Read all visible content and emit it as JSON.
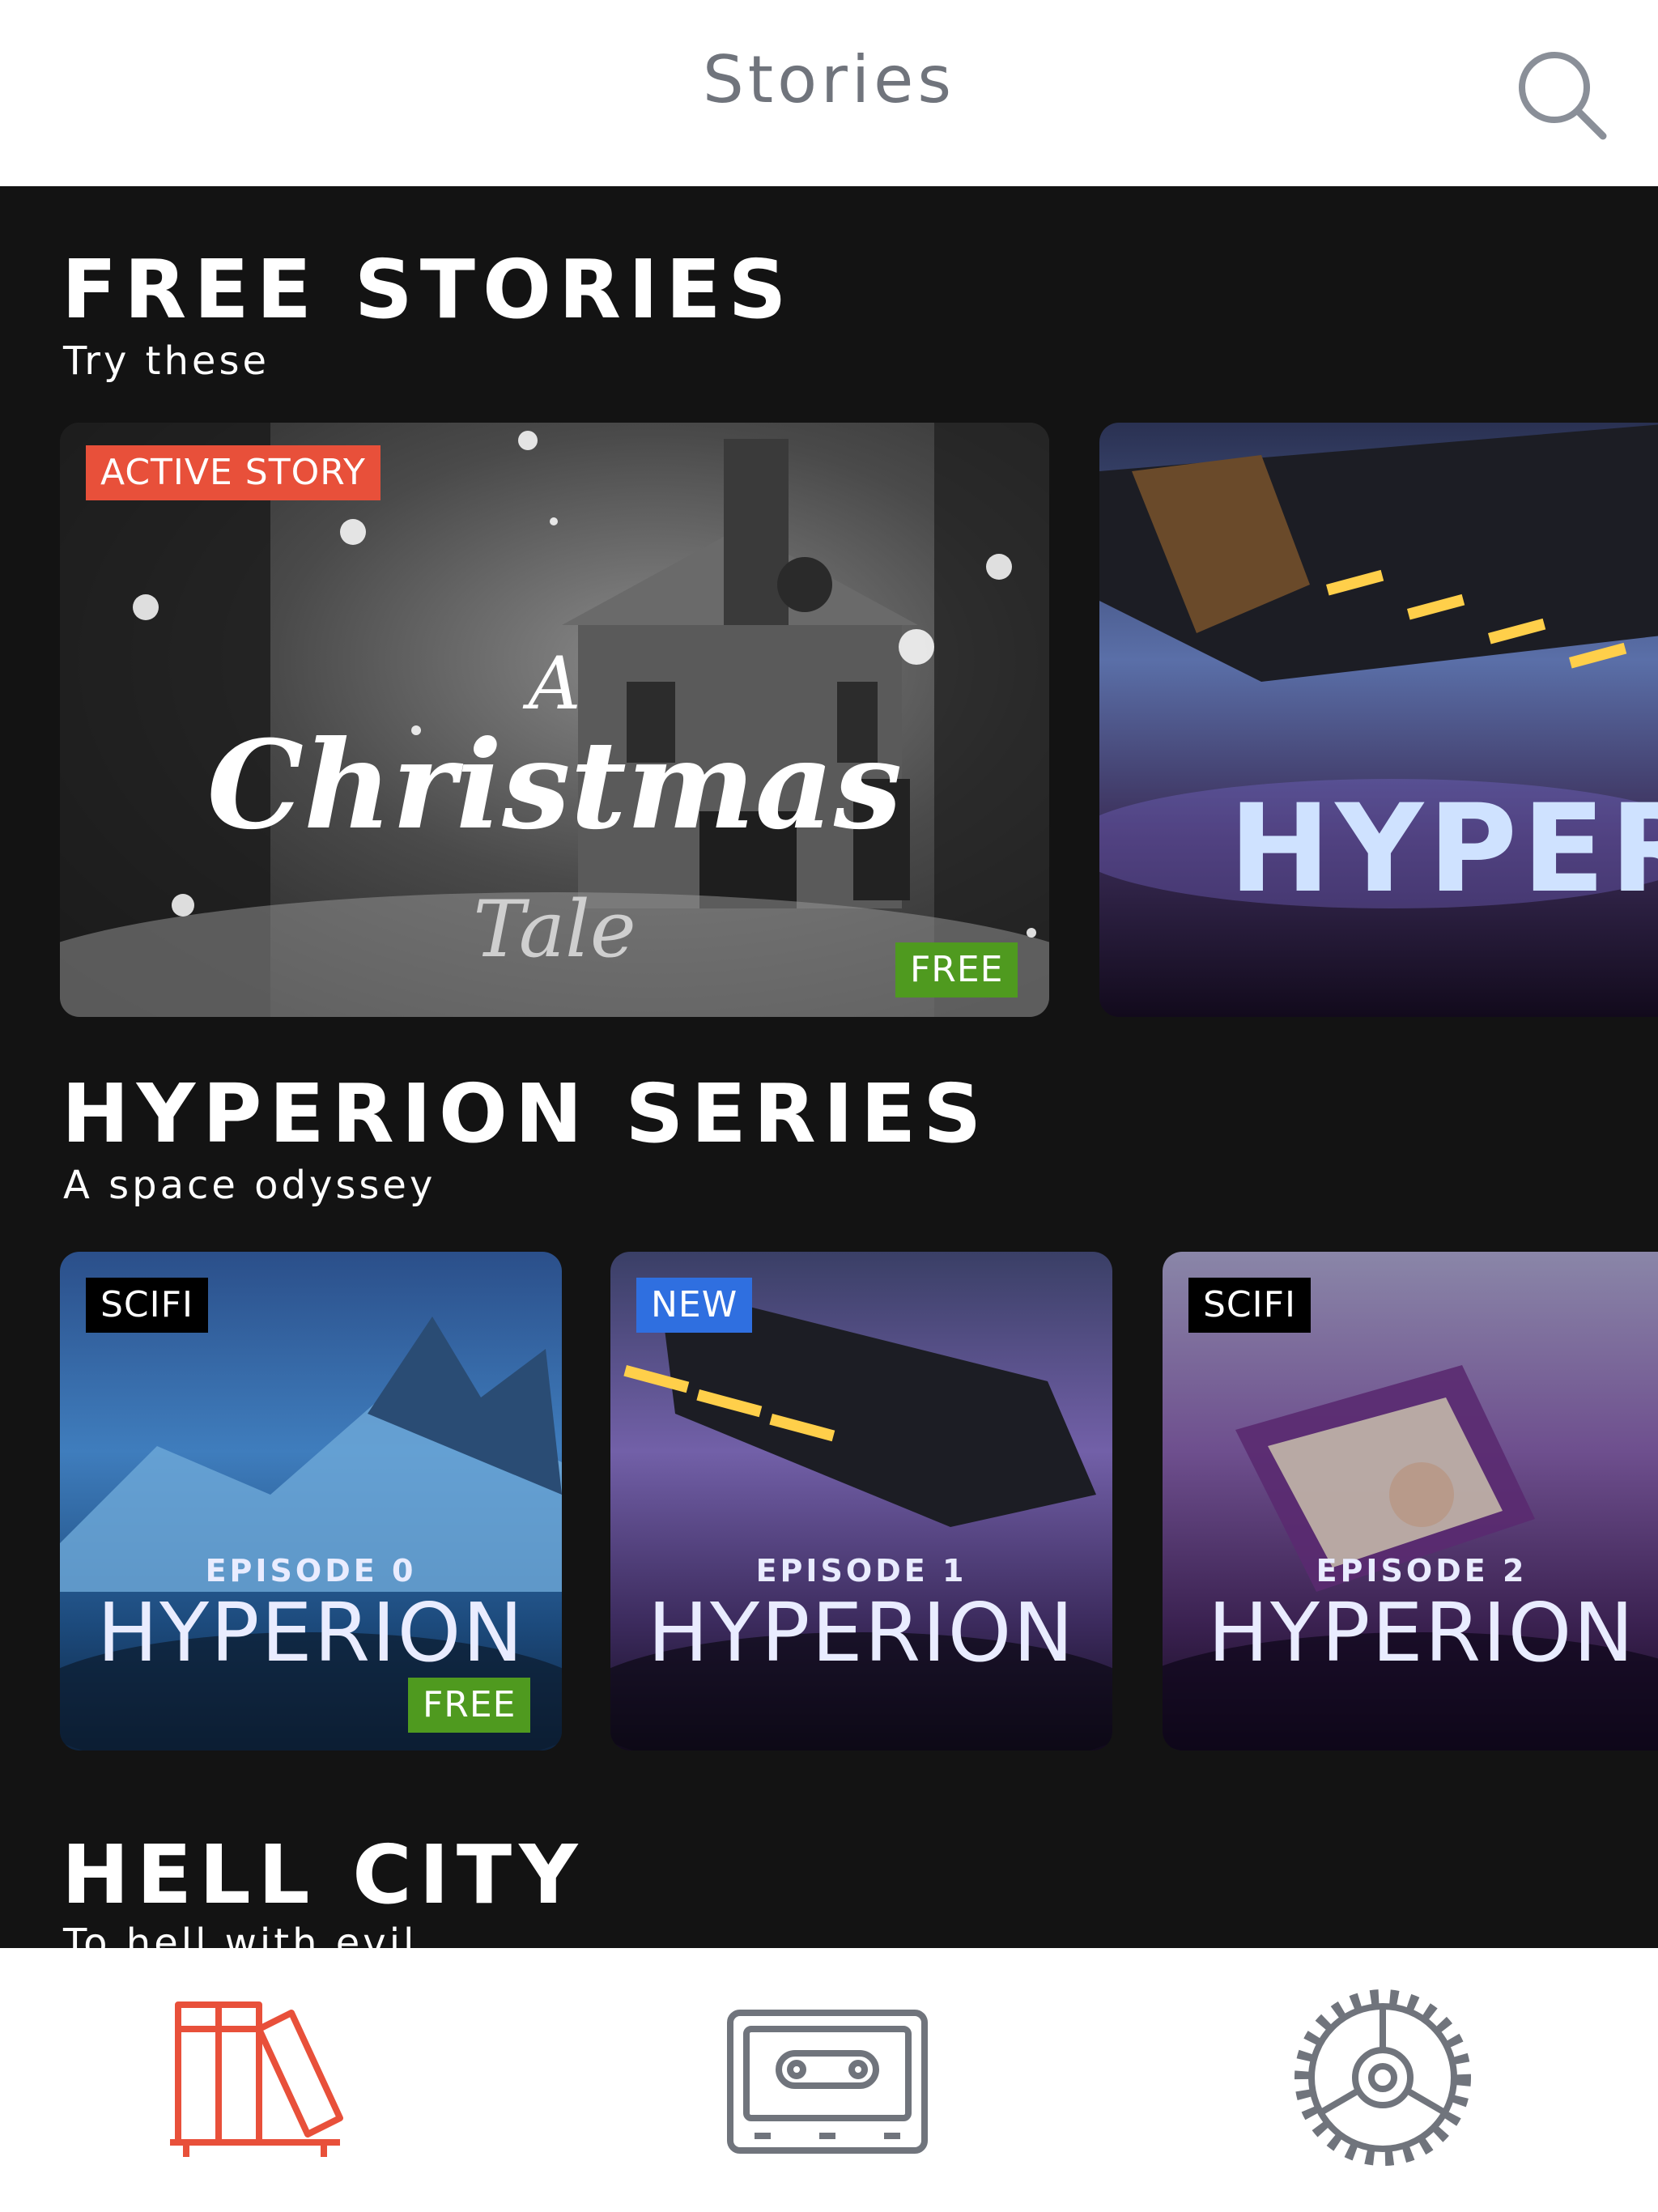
{
  "header": {
    "title": "Stories",
    "search_icon": "search-icon"
  },
  "sections": [
    {
      "title": "FREE STORIES",
      "subtitle": "Try these",
      "cards": [
        {
          "cover_title_1": "A",
          "cover_title_2": "Christmas",
          "cover_title_3": "Tale",
          "badge_top": "ACTIVE STORY",
          "badge_bottom": "FREE"
        },
        {
          "cover_title": "HYPER"
        }
      ]
    },
    {
      "title": "HYPERION SERIES",
      "subtitle": "A space odyssey",
      "cards": [
        {
          "episode": "EPISODE 0",
          "name": "HYPERION",
          "badge_top": "SCIFI",
          "badge_bottom": "FREE"
        },
        {
          "episode": "EPISODE 1",
          "name": "HYPERION",
          "badge_top": "NEW"
        },
        {
          "episode": "EPISODE 2",
          "name": "HYPERION",
          "badge_top": "SCIFI"
        }
      ]
    },
    {
      "title": "HELL CITY",
      "subtitle": "To hell with evil"
    }
  ],
  "colors": {
    "active_badge": "#e8503a",
    "free_badge": "#4f9a1f",
    "new_badge": "#2f6fe0",
    "scifi_badge": "#000000",
    "nav_active": "#e8503a",
    "nav_inactive": "#70747c"
  },
  "nav": [
    {
      "icon": "library-books-icon",
      "active": true
    },
    {
      "icon": "cassette-tape-icon",
      "active": false
    },
    {
      "icon": "gear-settings-icon",
      "active": false
    }
  ]
}
